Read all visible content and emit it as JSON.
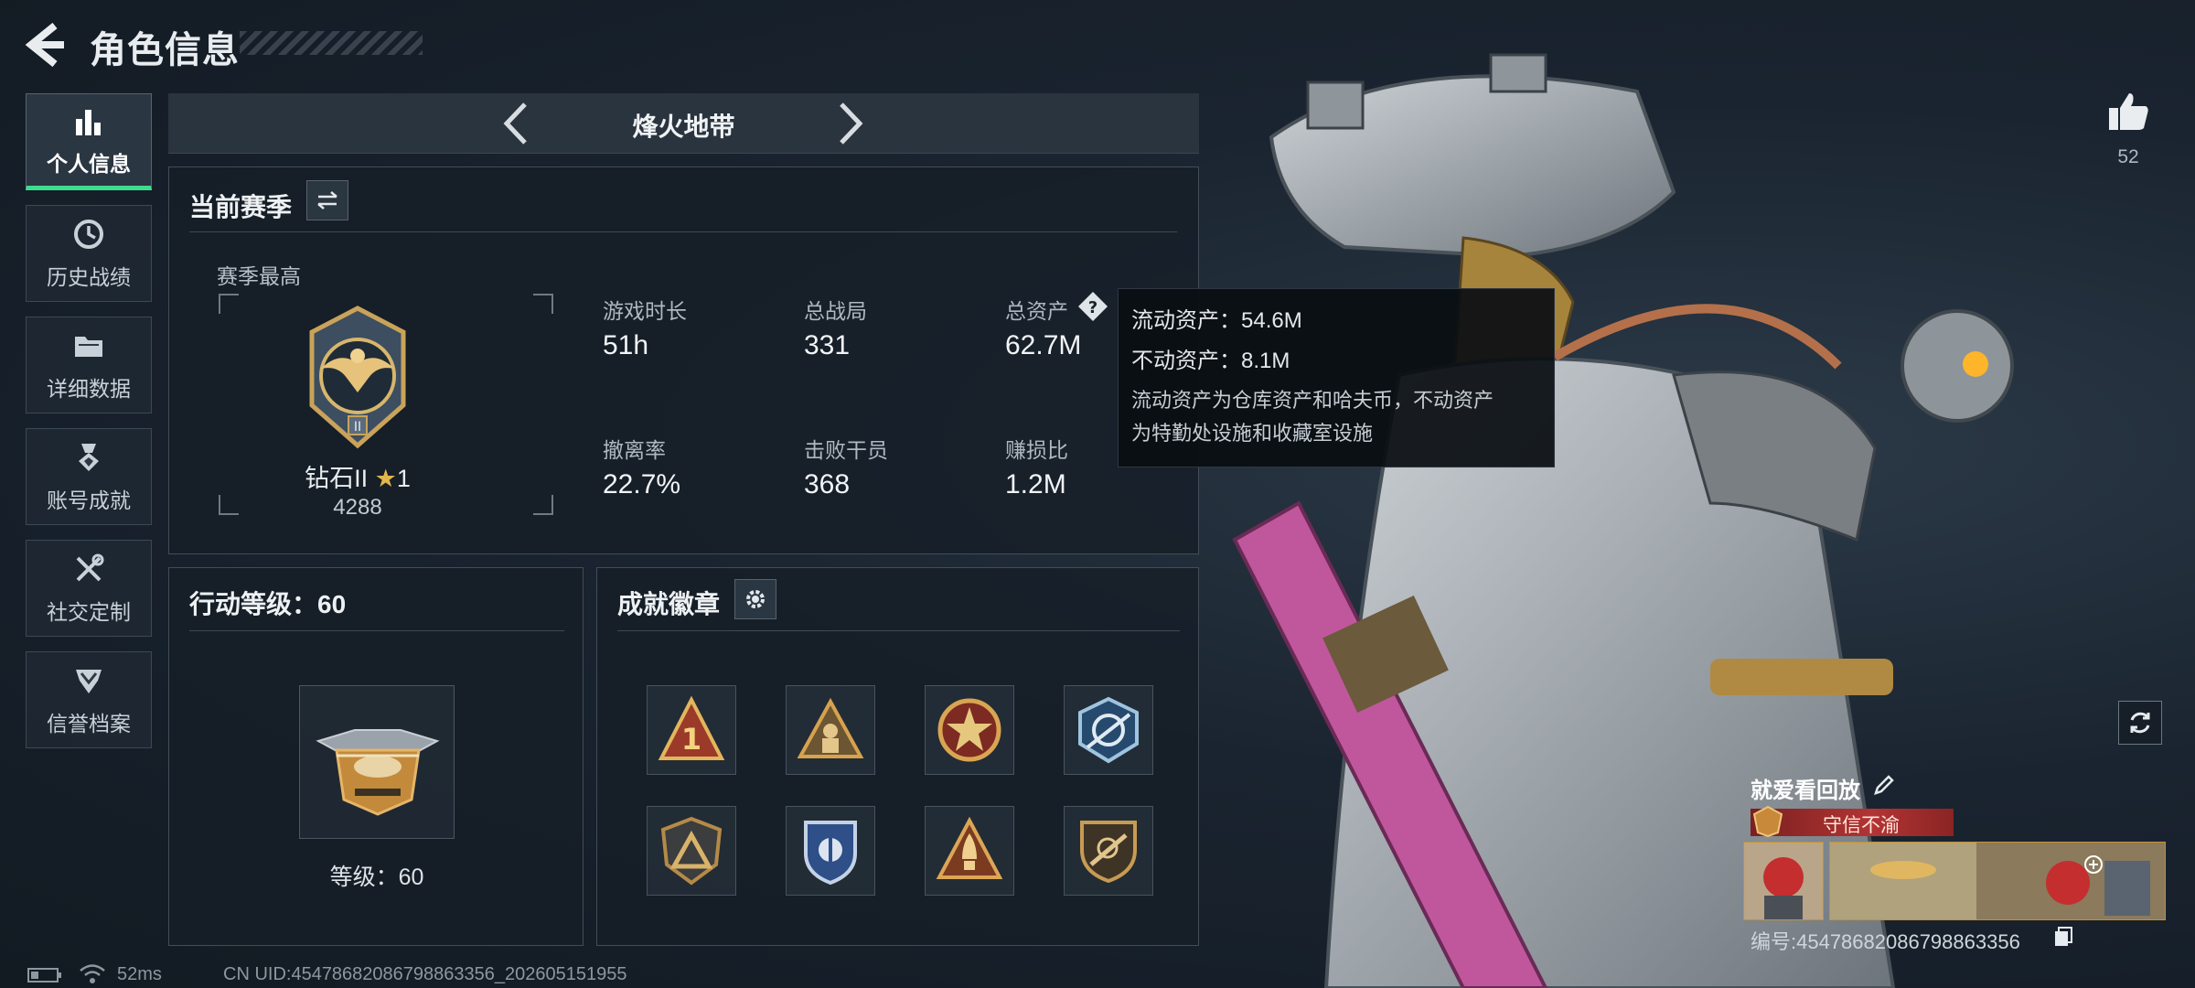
{
  "header": {
    "title": "角色信息"
  },
  "nav": [
    {
      "label": "个人信息",
      "icon": "bar-chart-icon",
      "active": true
    },
    {
      "label": "历史战绩",
      "icon": "clock-icon",
      "active": false
    },
    {
      "label": "详细数据",
      "icon": "folder-icon",
      "active": false
    },
    {
      "label": "账号成就",
      "icon": "medal-icon",
      "active": false
    },
    {
      "label": "社交定制",
      "icon": "tools-icon",
      "active": false
    },
    {
      "label": "信誉档案",
      "icon": "shield-chevron-icon",
      "active": false
    }
  ],
  "mode": {
    "title": "烽火地带"
  },
  "season": {
    "title": "当前赛季",
    "best_label": "赛季最高",
    "rank_name": "钻石II",
    "rank_stars": "1",
    "rank_points": "4288",
    "stats": [
      {
        "label": "游戏时长",
        "value": "51h"
      },
      {
        "label": "总战局",
        "value": "331"
      },
      {
        "label": "总资产",
        "value": "62.7M"
      },
      {
        "label": "撤离率",
        "value": "22.7%"
      },
      {
        "label": "击败干员",
        "value": "368"
      },
      {
        "label": "赚损比",
        "value": "1.2M"
      }
    ]
  },
  "tooltip": {
    "liquid": "流动资产：54.6M",
    "fixed": "不动资产：8.1M",
    "desc1": "流动资产为仓库资产和哈夫币，不动资产",
    "desc2": "为特勤处设施和收藏室设施"
  },
  "level": {
    "title": "行动等级：60",
    "caption": "等级：60"
  },
  "badges": {
    "title": "成就徽章",
    "items": [
      "rank-1-badge",
      "soldier-triangle-badge",
      "star-circle-badge",
      "blue-wing-badge",
      "triangle-shield-badge",
      "blue-shield-badge",
      "rocket-badge",
      "rifle-shield-badge"
    ]
  },
  "side": {
    "likes": "52",
    "replay_title": "就爱看回放",
    "honor": "守信不渝",
    "replay_code": "编号:4547868208679886335​6"
  },
  "footer": {
    "ping": "52ms",
    "uid": "CN UID:4547868208679886335​6_202605151955"
  },
  "colors": {
    "accent": "#3fdc8f",
    "honor": "#b33434",
    "tooltip_bg": "#0a0e12"
  }
}
